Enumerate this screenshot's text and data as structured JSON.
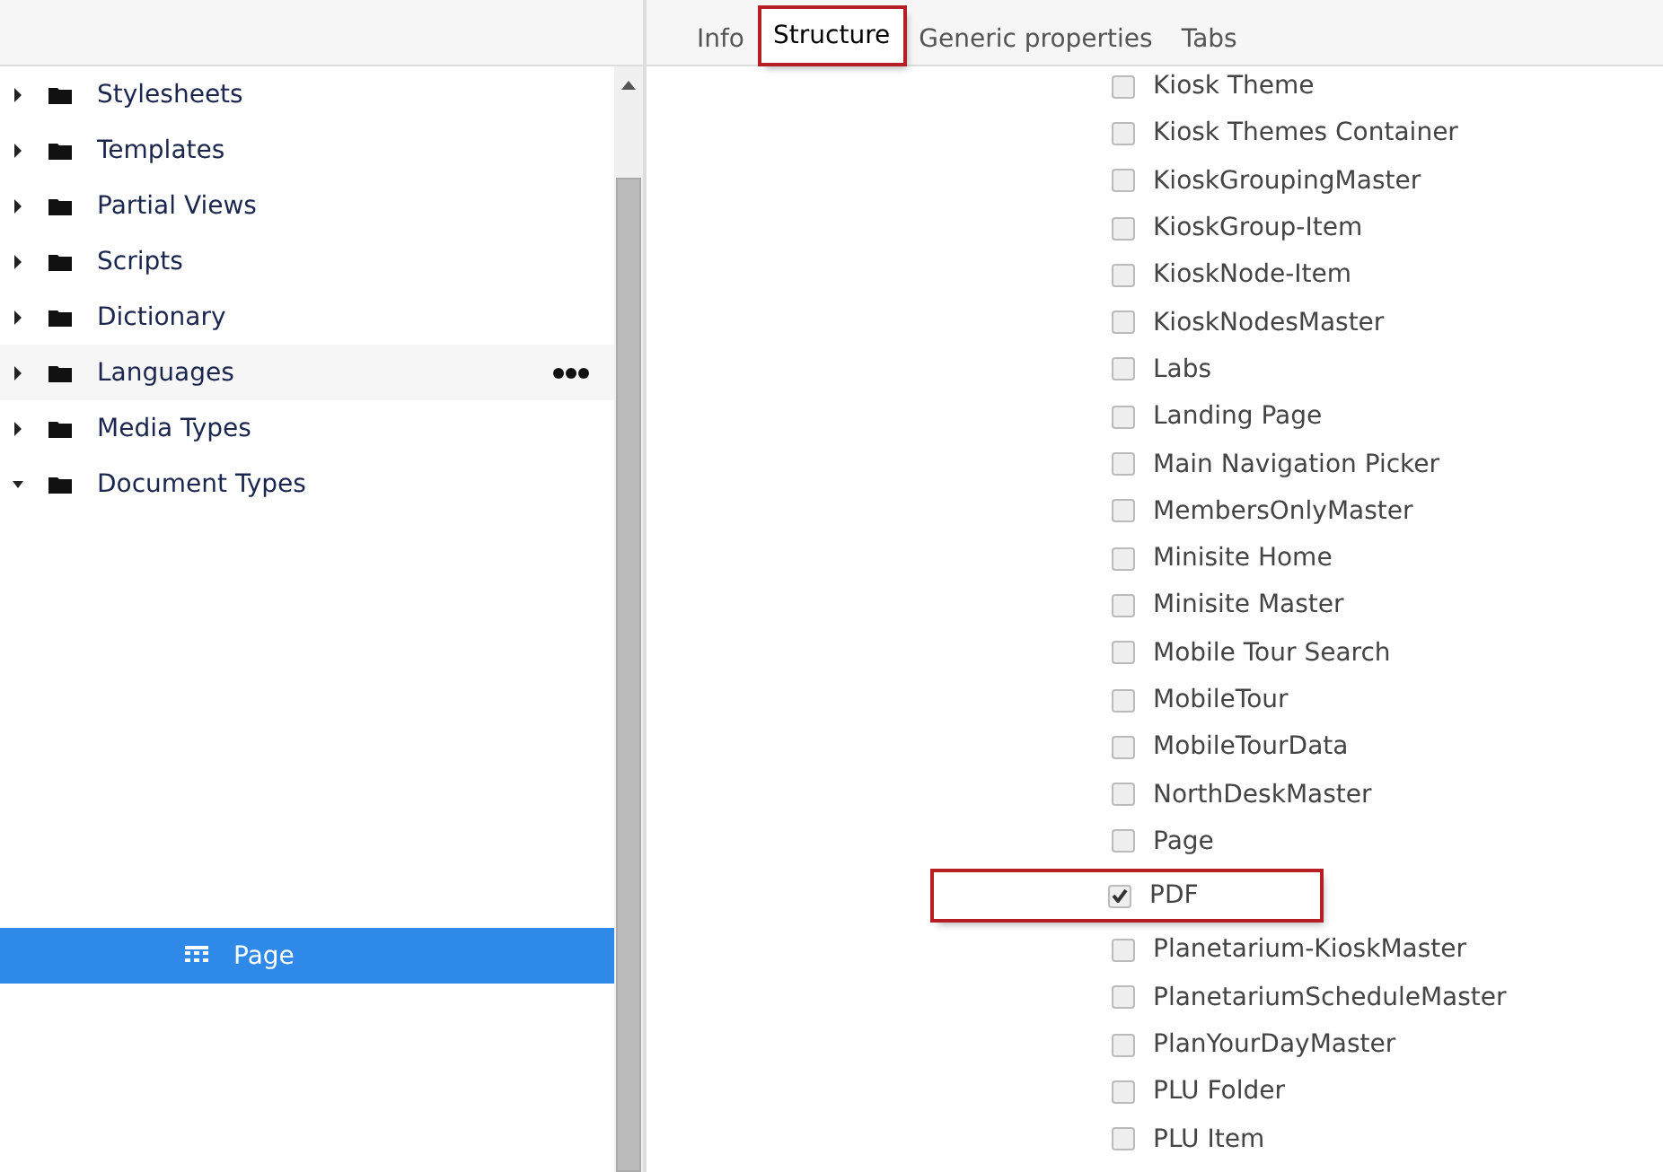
{
  "tree": {
    "items": [
      {
        "label": "Stylesheets",
        "expanded": false,
        "hovered": false,
        "selected": false
      },
      {
        "label": "Templates",
        "expanded": false,
        "hovered": false,
        "selected": false
      },
      {
        "label": "Partial Views",
        "expanded": false,
        "hovered": false,
        "selected": false
      },
      {
        "label": "Scripts",
        "expanded": false,
        "hovered": false,
        "selected": false
      },
      {
        "label": "Dictionary",
        "expanded": false,
        "hovered": false,
        "selected": false
      },
      {
        "label": "Languages",
        "expanded": false,
        "hovered": true,
        "selected": false
      },
      {
        "label": "Media Types",
        "expanded": false,
        "hovered": false,
        "selected": false
      },
      {
        "label": "Document Types",
        "expanded": true,
        "hovered": false,
        "selected": false,
        "children": [
          {
            "label": "Page",
            "selected": true
          }
        ]
      }
    ]
  },
  "tabs": [
    {
      "label": "Info",
      "selected": false,
      "highlighted": false
    },
    {
      "label": "Structure",
      "selected": true,
      "highlighted": true
    },
    {
      "label": "Generic properties",
      "selected": false,
      "highlighted": false
    },
    {
      "label": "Tabs",
      "selected": false,
      "highlighted": false
    }
  ],
  "allowed_types": [
    {
      "label": "Kiosk Theme",
      "checked": false,
      "highlighted": false
    },
    {
      "label": "Kiosk Themes Container",
      "checked": false,
      "highlighted": false
    },
    {
      "label": "KioskGroupingMaster",
      "checked": false,
      "highlighted": false
    },
    {
      "label": "KioskGroup-Item",
      "checked": false,
      "highlighted": false
    },
    {
      "label": "KioskNode-Item",
      "checked": false,
      "highlighted": false
    },
    {
      "label": "KioskNodesMaster",
      "checked": false,
      "highlighted": false
    },
    {
      "label": "Labs",
      "checked": false,
      "highlighted": false
    },
    {
      "label": "Landing Page",
      "checked": false,
      "highlighted": false
    },
    {
      "label": "Main Navigation Picker",
      "checked": false,
      "highlighted": false
    },
    {
      "label": "MembersOnlyMaster",
      "checked": false,
      "highlighted": false
    },
    {
      "label": "Minisite Home",
      "checked": false,
      "highlighted": false
    },
    {
      "label": "Minisite Master",
      "checked": false,
      "highlighted": false
    },
    {
      "label": "Mobile Tour Search",
      "checked": false,
      "highlighted": false
    },
    {
      "label": "MobileTour",
      "checked": false,
      "highlighted": false
    },
    {
      "label": "MobileTourData",
      "checked": false,
      "highlighted": false
    },
    {
      "label": "NorthDeskMaster",
      "checked": false,
      "highlighted": false
    },
    {
      "label": "Page",
      "checked": false,
      "highlighted": false
    },
    {
      "label": "PDF",
      "checked": true,
      "highlighted": true
    },
    {
      "label": "Planetarium-KioskMaster",
      "checked": false,
      "highlighted": false
    },
    {
      "label": "PlanetariumScheduleMaster",
      "checked": false,
      "highlighted": false
    },
    {
      "label": "PlanYourDayMaster",
      "checked": false,
      "highlighted": false
    },
    {
      "label": "PLU Folder",
      "checked": false,
      "highlighted": false
    },
    {
      "label": "PLU Item",
      "checked": false,
      "highlighted": false
    }
  ]
}
